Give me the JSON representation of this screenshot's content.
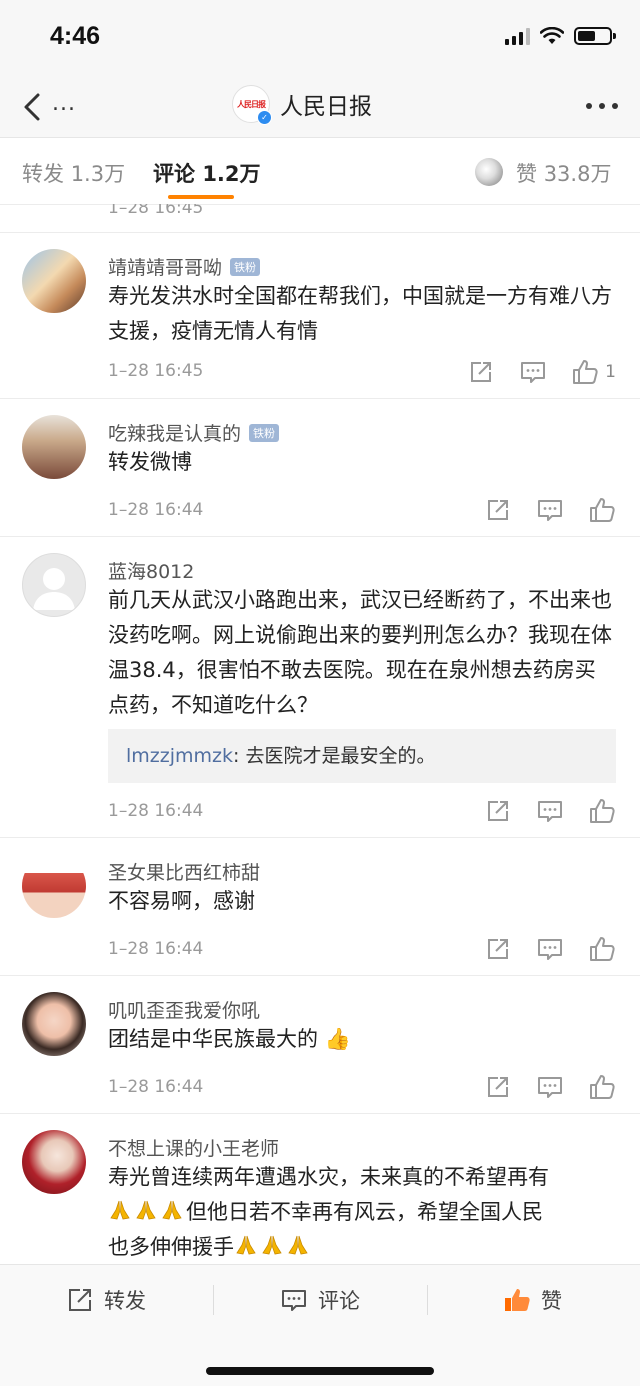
{
  "status": {
    "time": "4:46"
  },
  "nav": {
    "more_left": "...",
    "logo_text": "人民日报",
    "title": "人民日报"
  },
  "tabs": {
    "repost_label": "转发",
    "repost_count": "1.3万",
    "comment_label": "评论",
    "comment_count": "1.2万",
    "like_label": "赞",
    "like_count": "33.8万"
  },
  "partial_date": "1–28 16:45",
  "comments": [
    {
      "name": "靖靖靖哥哥呦",
      "badge": "铁粉",
      "text": "寿光发洪水时全国都在帮我们，中国就是一方有难八方支援，疫情无情人有情",
      "date": "1–28 16:45",
      "likes": "1"
    },
    {
      "name": "吃辣我是认真的",
      "badge": "铁粉",
      "text": "转发微博",
      "date": "1–28 16:44",
      "likes": ""
    },
    {
      "name": "蓝海8012",
      "badge": "",
      "text": "前几天从武汉小路跑出来，武汉已经断药了，不出来也没药吃啊。网上说偷跑出来的要判刑怎么办？我现在体温38.4，很害怕不敢去医院。现在在泉州想去药房买点药，不知道吃什么？",
      "reply_name": "lmzzjmmzk",
      "reply_text": ": 去医院才是最安全的。",
      "date": "1–28 16:44",
      "likes": ""
    },
    {
      "name": "圣女果比西红柿甜",
      "badge": "",
      "text": "不容易啊，感谢",
      "date": "1–28 16:44",
      "likes": ""
    },
    {
      "name": "叽叽歪歪我爱你吼",
      "badge": "",
      "text": "团结是中华民族最大的",
      "emoji": "👍",
      "date": "1–28 16:44",
      "likes": ""
    },
    {
      "name": "不想上课的小王老师",
      "badge": "",
      "line1": "寿光曾连续两年遭遇水灾，未来真的不希望再有",
      "line2": "但他日若不幸再有风云，希望全国人民",
      "line3": "也多伸伸援手"
    }
  ],
  "bottom": {
    "repost": "转发",
    "comment": "评论",
    "like": "赞"
  },
  "colors": {
    "accent": "#ff8200",
    "like_active": "#ff6a00",
    "reply_name": "#506ea0"
  }
}
